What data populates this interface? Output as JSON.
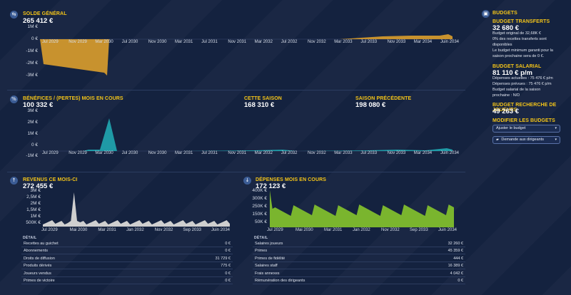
{
  "solde": {
    "title": "SOLDE GÉNÉRAL",
    "value": "265 412 €",
    "y_ticks": [
      "1M €",
      "0 €",
      "-1M €",
      "-2M €",
      "-3M €"
    ],
    "x_ticks": [
      "Jul 2029",
      "Nov 2029",
      "Mar 2030",
      "Jul 2030",
      "Nov 2030",
      "Mar 2031",
      "Jul 2031",
      "Nov 2031",
      "Mar 2032",
      "Jul 2032",
      "Nov 2032",
      "Mar 2033",
      "Jul 2033",
      "Nov 2033",
      "Mar 2034",
      "Juin 2034"
    ],
    "color": "#c8922e"
  },
  "benefices": {
    "title": "BÉNÉFICES / (PERTES) MOIS EN COURS",
    "value": "100 332 €",
    "saison_title": "CETTE SAISON",
    "saison_value": "168 310 €",
    "prec_title": "SAISON PRÉCÉDENTE",
    "prec_value": "198 080 €",
    "y_ticks": [
      "3M €",
      "2M €",
      "1M €",
      "0 €",
      "-1M €"
    ],
    "x_ticks": [
      "Jul 2029",
      "Nov 2029",
      "Mar 2030",
      "Jul 2030",
      "Nov 2030",
      "Mar 2031",
      "Jul 2031",
      "Nov 2031",
      "Mar 2032",
      "Jul 2032",
      "Nov 2032",
      "Mar 2033",
      "Jul 2033",
      "Nov 2033",
      "Mar 2034",
      "Juin 2034"
    ],
    "color": "#1f9aa6"
  },
  "revenus": {
    "title": "REVENUS CE MOIS-CI",
    "value": "272 455 €",
    "y_ticks": [
      "3M €",
      "2,5M €",
      "2M €",
      "1,5M €",
      "1M €",
      "500K €"
    ],
    "x_ticks": [
      "Jul 2029",
      "Mai 2030",
      "Mar 2031",
      "Jan 2032",
      "Nov 2032",
      "Sep 2033",
      "Juin 2034"
    ],
    "color": "#cfcfcf",
    "detail_title": "DÉTAIL",
    "rows": [
      {
        "label": "Recettes au guichet",
        "value": "0 €"
      },
      {
        "label": "Abonnements",
        "value": "0 €"
      },
      {
        "label": "Droits de diffusion",
        "value": "31 729 €"
      },
      {
        "label": "Produits dérivés",
        "value": "775 €"
      },
      {
        "label": "Joueurs vendus",
        "value": "0 €"
      },
      {
        "label": "Primes de victoire",
        "value": "0 €"
      }
    ]
  },
  "depenses": {
    "title": "DÉPENSES MOIS EN COURS",
    "value": "172 123 €",
    "y_ticks": [
      "400K €",
      "300K €",
      "250K €",
      "150K €",
      "50K €"
    ],
    "x_ticks": [
      "Jul 2029",
      "Mai 2030",
      "Mar 2031",
      "Jan 2032",
      "Nov 2032",
      "Sep 2033",
      "Juin 2034"
    ],
    "color": "#7ab52e",
    "detail_title": "DÉTAIL",
    "rows": [
      {
        "label": "Salaires joueurs",
        "value": "32 260 €"
      },
      {
        "label": "Primes",
        "value": "45 359 €"
      },
      {
        "label": "Primes de fidélité",
        "value": "444 €"
      },
      {
        "label": "Salaires staff",
        "value": "16 389 €"
      },
      {
        "label": "Frais annexes",
        "value": "4 042 €"
      },
      {
        "label": "Rémunération des dirigeants",
        "value": "0 €"
      }
    ]
  },
  "budgets": {
    "title": "BUDGETS",
    "transfer_title": "BUDGET TRANSFERTS",
    "transfer_value": "32 680 €",
    "transfer_lines": [
      "Budget original de 32,68K €",
      "0% des recettes transferts sont disponibles",
      "Le budget minimum garanti pour la saison prochaine sera de 0 €."
    ],
    "salary_title": "BUDGET SALARIAL",
    "salary_value": "81 110 € p/m",
    "salary_lines": [
      "Dépenses actuelles : 75 476 € p/m",
      "Dépenses prévues : 75 476 € p/m",
      "Budget salarial de la saison prochaine : N/D"
    ],
    "scout_title": "BUDGET RECHERCHE DE JOUEURS",
    "scout_value": "49 263 €",
    "modify_title": "MODIFIER LES BUDGETS",
    "adjust_label": "Ajuster le budget",
    "request_label": "Demande aux dirigeants"
  }
}
